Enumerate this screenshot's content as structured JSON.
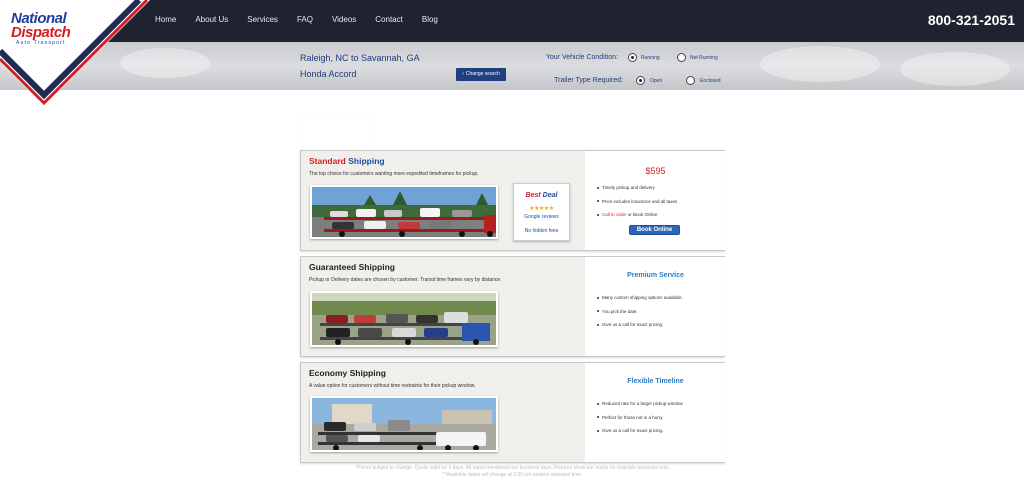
{
  "brand": {
    "line1": "National",
    "line2": "Dispatch",
    "line3": "Auto Transport",
    "colors": {
      "navy": "#1f3f99",
      "red": "#d21f26"
    }
  },
  "nav": {
    "items": [
      "Home",
      "About Us",
      "Services",
      "FAQ",
      "Videos",
      "Contact",
      "Blog"
    ]
  },
  "phone": "800-321-2051",
  "quote": {
    "route": "Raleigh, NC to Savannah, GA",
    "vehicle": "Honda Accord",
    "change_label": "Change search",
    "condition_label": "Your Vehicle Condition:",
    "condition_options": [
      "Running",
      "Not Running"
    ],
    "condition_selected": "Running",
    "trailer_label": "Trailer Type Required:",
    "trailer_options": [
      "Open",
      "Enclosed"
    ],
    "trailer_selected": "Open"
  },
  "cards": {
    "standard": {
      "title_red": "Standard",
      "title_blue": "Shipping",
      "desc": "The top choice for customers wanting more expedited timeframes for pickup.",
      "deal": {
        "best": "Best",
        "deal": "Deal",
        "stars": "★★★★★",
        "reviews": "Google reviews",
        "no_hidden": "No hidden fees"
      },
      "price": "$595",
      "bullets": [
        "Timely pickup and delivery",
        "Price includes insurance and all taxes"
      ],
      "call_text": "Call to order",
      "call_suffix": " or Book Online",
      "book_label": "Book Online"
    },
    "guaranteed": {
      "title": "Guaranteed Shipping",
      "desc": "Pickup or Delivery dates are chosen by customer. Transit time frames vary by distance.",
      "heading": "Premium Service",
      "bullets": [
        "Many custom shipping options available.",
        "You pick the date.",
        "Give us a call for exact pricing."
      ]
    },
    "economy": {
      "title": "Economy Shipping",
      "desc": "A value option for customers without time restraints for their pickup window.",
      "heading": "Flexible Timeline",
      "bullets": [
        "Reduced rate for a larger pickup window.",
        "Perfect for those not in a hurry.",
        "Give us a call for exact pricing."
      ]
    }
  },
  "footnotes": {
    "line1": "*Prices subject to change. Quote valid for 5 days. All dates mentioned are business days. Pictures show our trucks for example purposes only.",
    "line2": "**Available dates will change at 2:00 pm eastern standard time."
  }
}
